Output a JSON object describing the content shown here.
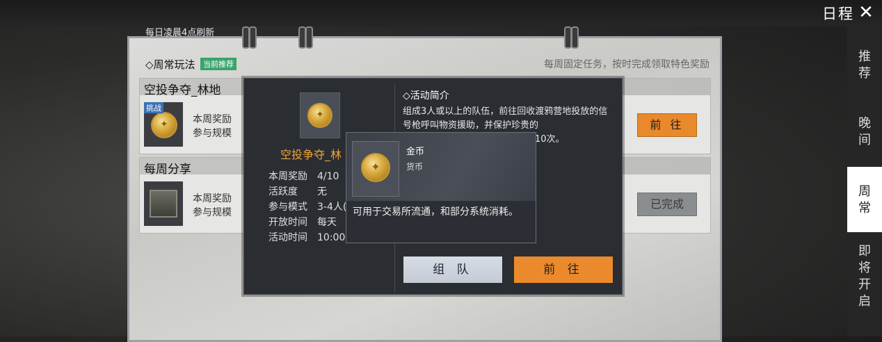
{
  "header": {
    "title": "日程",
    "close_icon": "close-icon"
  },
  "board": {
    "refresh_note": "每日凌晨4点刷新",
    "section_title": "◇周常玩法",
    "recommend_badge": "当前推荐",
    "section_note": "每周固定任务，按时完成领取特色奖励"
  },
  "tasks": [
    {
      "name": "空投争夺_林地",
      "badge": "挑战",
      "reward_label": "本周奖励",
      "rule_label": "参与规模",
      "button": "前 往",
      "icon": "coin-icon"
    },
    {
      "name": "每周分享",
      "reward_label": "本周奖励",
      "rule_label": "参与规模",
      "button": "已完成",
      "icon": "crate-icon"
    }
  ],
  "side_tabs": [
    {
      "label": "推荐",
      "active": false
    },
    {
      "label": "晚间",
      "active": false
    },
    {
      "label": "周常",
      "active": true
    },
    {
      "label": "即将开启",
      "active": false
    }
  ],
  "detail": {
    "name": "空投争夺_林",
    "rows": [
      {
        "k": "本周奖励",
        "v": "4/10"
      },
      {
        "k": "活跃度",
        "v": "无"
      },
      {
        "k": "参与模式",
        "v": "3-4人("
      },
      {
        "k": "开放时间",
        "v": "每天"
      },
      {
        "k": "活动时间",
        "v": "10:00-"
      }
    ],
    "intro_title": "◇活动简介",
    "intro_text": "组成3人或以上的队伍，前往回收渡鸦营地投放的信号枪呼叫物资援助，并保护珍贵的",
    "intro_tail": "10次。",
    "team_button": "组 队",
    "goto_button": "前 往"
  },
  "tooltip": {
    "name": "金币",
    "type": "货币",
    "desc": "可用于交易所流通，和部分系统消耗。"
  },
  "colors": {
    "accent": "#eb8a2c",
    "badge_green": "#3aa46b",
    "name_orange": "#f0a23a"
  }
}
